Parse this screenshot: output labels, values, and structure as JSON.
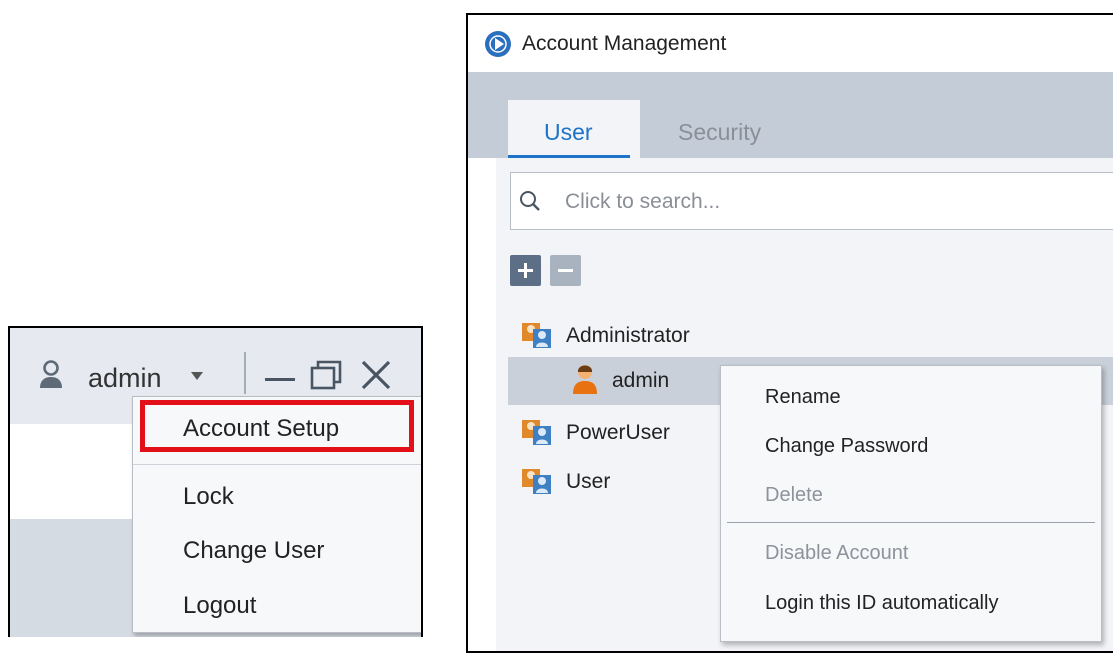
{
  "left_panel": {
    "username": "admin",
    "menu_items": [
      "Account Setup",
      "Lock",
      "Change User",
      "Logout"
    ],
    "highlighted_item": "Account Setup",
    "highlight_color": "#e3101a",
    "icons": [
      "user-icon",
      "caret-down-icon",
      "minimize-icon",
      "restore-icon",
      "close-icon"
    ]
  },
  "right_panel": {
    "title": "Account Management",
    "tabs": [
      {
        "label": "User",
        "active": true
      },
      {
        "label": "Security",
        "active": false
      }
    ],
    "search_placeholder": "Click to search...",
    "tree": {
      "groups": [
        {
          "label": "Administrator",
          "children": [
            {
              "label": "admin",
              "selected": true
            }
          ]
        },
        {
          "label": "PowerUser",
          "children": []
        },
        {
          "label": "User",
          "children": []
        }
      ]
    },
    "context_menu": {
      "items": [
        {
          "label": "Rename",
          "enabled": true
        },
        {
          "label": "Change Password",
          "enabled": true
        },
        {
          "label": "Delete",
          "enabled": false
        },
        {
          "label": "Disable Account",
          "enabled": false
        },
        {
          "label": "Login this ID automatically",
          "enabled": true
        }
      ]
    },
    "accent_color": "#1e73c8",
    "icons": [
      "app-logo-icon",
      "search-icon",
      "add-icon",
      "remove-icon",
      "group-icon",
      "person-icon"
    ]
  }
}
